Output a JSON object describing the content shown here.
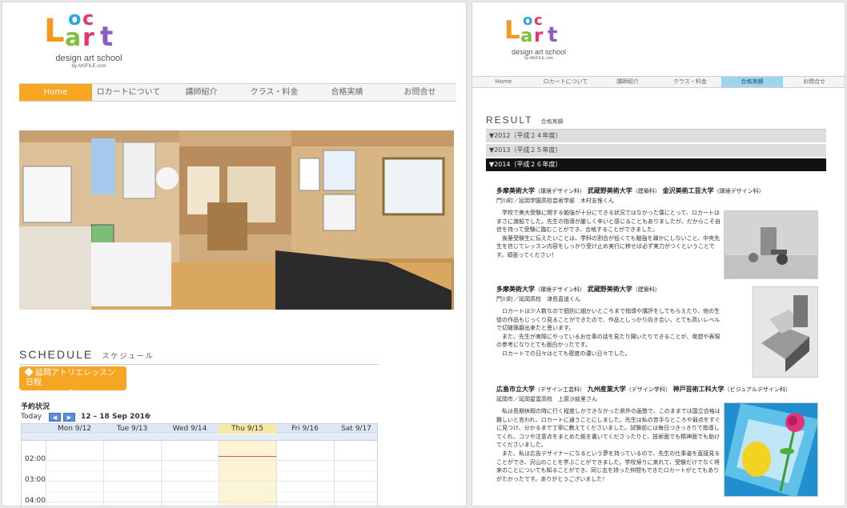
{
  "logo": {
    "letters": [
      "L",
      "o",
      "c",
      "a",
      "r",
      "t"
    ],
    "letter_colors": [
      "#f39a1e",
      "#2ea7e0",
      "#e8336c",
      "#7fbf3f",
      "#e8336c",
      "#8a5cc4"
    ],
    "school": "design art school",
    "by": "by AKIFILE.com"
  },
  "left_nav": {
    "items": [
      "Home",
      "ロカートについて",
      "講師紹介",
      "クラス・料金",
      "合格実績",
      "お問合せ"
    ],
    "active_index": 0,
    "active_color": "#f6a623"
  },
  "right_nav": {
    "items": [
      "Home",
      "ロカートについて",
      "講師紹介",
      "クラス・料金",
      "合格実績",
      "お問合せ"
    ],
    "active_index": 4,
    "active_color": "#9fd4ee"
  },
  "schedule": {
    "title": "SCHEDULE",
    "title_ja": "スケジュール",
    "button_label": "延岡アトリエレッスン日程",
    "calendar_name": "予約状況",
    "today_label": "Today",
    "prev_icon": "chevron-left-icon",
    "next_icon": "chevron-right-icon",
    "date_range": "12 – 18 Sep 2016",
    "days": [
      "Mon 9/12",
      "Tue 9/13",
      "Wed 9/14",
      "Thu 9/15",
      "Fri 9/16",
      "Sat 9/17"
    ],
    "today_day_index": 3,
    "times": [
      "02:00",
      "03:00",
      "04:00"
    ]
  },
  "result": {
    "title": "RESULT",
    "title_ja": "合格実績",
    "years": [
      "▼2012（平成２４年度）",
      "▼2013（平成２５年度）",
      "▼2014（平成２６年度）"
    ],
    "open_year_index": 2,
    "entries": [
      {
        "schools": [
          {
            "name": "多摩美術大学",
            "dept": "（環境デザイン科）"
          },
          {
            "name": "武蔵野美術大学",
            "dept": "（建築科）"
          },
          {
            "name": "金沢美術工芸大学",
            "dept": "（環境デザイン科）"
          }
        ],
        "student": "門川町／延岡学園高校芸術学部　木村友惟くん",
        "paragraphs": [
          "学校で美大受験に関する勉強が十分にできる状況ではなかった僕にとって、ロカートはまさに渡船でした。先生の指導が厳しく辛いと感じることもありましたが、だからこそ自信を持って受験に臨むことができ、合格することができました。",
          "後輩受験生に伝えたいことは、学科の割合が低くても勉強を疎かにしないこと、中央先生を信じてレッスン内容をしっかり受け止め実行に移せば必ず実力がつくということです。頑張ってください！"
        ],
        "image_icon": "pencil-drawing-still-life-image"
      },
      {
        "schools": [
          {
            "name": "多摩美術大学",
            "dept": "（環境デザイン科）"
          },
          {
            "name": "武蔵野美術大学",
            "dept": "（建築科）"
          }
        ],
        "student": "門川町／延岡高校　津島直道くん",
        "paragraphs": [
          "ロカートは少人数なので個別に細かいところまで指導や講評をしてもらえたり、他の生徒の作品もじっくり見ることができたので、作品としっかり向き合い、とても高いレベルで切磋琢磨出来たと思います。",
          "また、先生が実際にやっているお仕事の話を見たり聞いたりできることが、発想や表現の参考になりとても面白かったです。",
          "ロカートでの日々はとても密度の濃い日々でした。"
        ],
        "image_icon": "pencil-drawing-geometric-image"
      },
      {
        "schools": [
          {
            "name": "広島市立大学",
            "dept": "（デザイン工芸科）"
          },
          {
            "name": "九州産業大学",
            "dept": "（デザイン学科）"
          },
          {
            "name": "神戸芸術工科大学",
            "dept": "（ビジュアルデザイン科）"
          }
        ],
        "student": "延岡市／延岡星雲高校　上原沙絵里さん",
        "paragraphs": [
          "私は長期休暇の時に行く程度しかできなかった県外の画塾で、このままでは国立合格は難しいと言われ、ロカートに通うことにしました。先生は私の苦手なところや弱点をすぐに見つけ、分かるまで丁寧に教えてくださいました。試験前には毎日つきっきりで指導してくれ、コツや注意点をまとめた紙を書いてくださったりと、技術面でも精神面でも助けてくださいました。",
          "また、私は広告デザイナーになるという夢を持っているので、先生の仕事姿を直接見ることができ、沢山のことを学ぶことができました。学校帰りに来れて、受験だけでなく将来のことについても知ることができ、同じ志を持った仲間もできたロカートがとてもありがたかったです。ありがとうございました！"
        ],
        "image_icon": "color-illustration-lemon-rose-image"
      }
    ]
  }
}
